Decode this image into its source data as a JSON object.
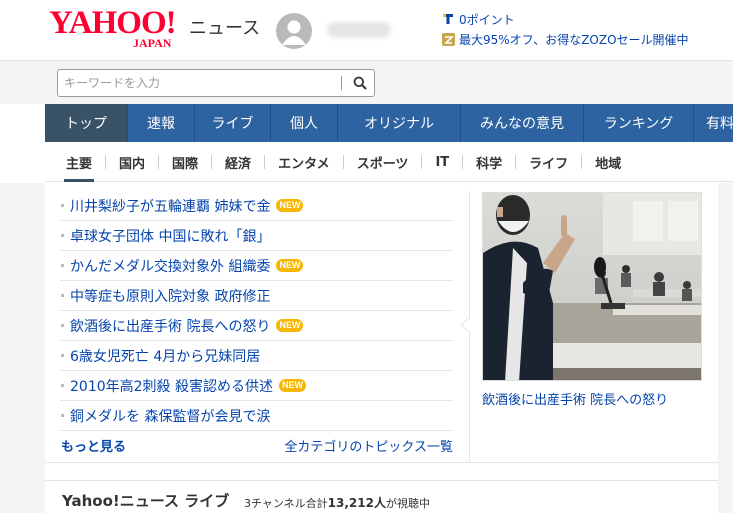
{
  "header": {
    "logo_text": "YAHOO!",
    "logo_sub": "JAPAN",
    "service_name": "ニュース",
    "points_text": "0ポイント",
    "promo_text": "最大95%オフ、お得なZOZOセール開催中"
  },
  "search": {
    "placeholder": "キーワードを入力",
    "value": ""
  },
  "main_nav": [
    {
      "label": "トップ",
      "active": true
    },
    {
      "label": "速報"
    },
    {
      "label": "ライブ"
    },
    {
      "label": "個人"
    },
    {
      "label": "オリジナル"
    },
    {
      "label": "みんなの意見"
    },
    {
      "label": "ランキング"
    },
    {
      "label": "有料"
    }
  ],
  "sub_nav": [
    {
      "label": "主要",
      "active": true
    },
    {
      "label": "国内"
    },
    {
      "label": "国際"
    },
    {
      "label": "経済"
    },
    {
      "label": "エンタメ"
    },
    {
      "label": "スポーツ"
    },
    {
      "label": "IT"
    },
    {
      "label": "科学"
    },
    {
      "label": "ライフ"
    },
    {
      "label": "地域"
    }
  ],
  "topics": [
    {
      "title": "川井梨紗子が五輪連覇 姉妹で金",
      "badge": "NEW"
    },
    {
      "title": "卓球女子団体 中国に敗れ「銀」",
      "badge": ""
    },
    {
      "title": "かんだメダル交換対象外 組織委",
      "badge": "NEW"
    },
    {
      "title": "中等症も原則入院対象 政府修正",
      "badge": ""
    },
    {
      "title": "飲酒後に出産手術 院長への怒り",
      "badge": "NEW"
    },
    {
      "title": "6歳女児死亡 4月から兄妹同居",
      "badge": ""
    },
    {
      "title": "2010年高2刺殺 殺害認める供述",
      "badge": "NEW"
    },
    {
      "title": "銅メダルを 森保監督が会見で涙",
      "badge": ""
    }
  ],
  "topics_footer": {
    "more_label": "もっと見る",
    "all_categories_label": "全カテゴリのトピックス一覧"
  },
  "feature": {
    "caption": "飲酒後に出産手術 院長への怒り"
  },
  "live": {
    "title": "Yahoo!ニュース ライブ",
    "viewers_prefix": "3チャンネル合計",
    "viewers_count": "13,212人",
    "viewers_suffix": "が視聴中"
  },
  "colors": {
    "brand_red": "#ff0033",
    "nav_blue": "#2e63a2",
    "nav_active": "#3a5266",
    "link_blue": "#0645ad",
    "new_badge": "#f7b600"
  },
  "icons": {
    "search": "search-icon",
    "tpoint": "tpoint-icon",
    "zozo": "zozo-icon",
    "avatar": "avatar-icon"
  }
}
